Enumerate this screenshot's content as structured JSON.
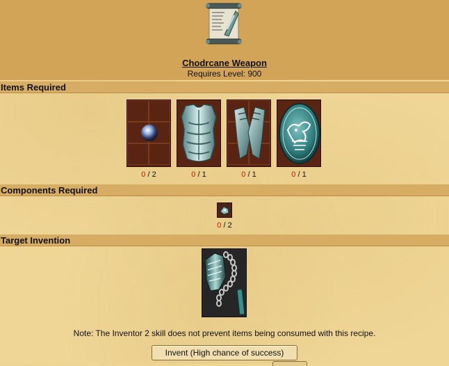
{
  "recipe": {
    "title": "Chodrcane Weapon",
    "requires_level": "Requires Level: 900"
  },
  "sections": {
    "items_required": "Items Required",
    "components_required": "Components Required",
    "target_invention": "Target Invention"
  },
  "items": [
    {
      "icon": "pearl-orb-icon",
      "have": "0",
      "need": " / 2"
    },
    {
      "icon": "breastplate-armor-icon",
      "have": "0",
      "need": " / 1"
    },
    {
      "icon": "gauntlets-icon",
      "have": "0",
      "need": " / 1"
    },
    {
      "icon": "engraved-shield-icon",
      "have": "0",
      "need": " / 1"
    }
  ],
  "components": [
    {
      "icon": "component-gem-icon",
      "have": "0",
      "need": " / 2"
    }
  ],
  "target": {
    "icon": "flail-weapon-icon"
  },
  "note": "Note: The Inventor 2 skill does not prevent items being consumed with this recipe.",
  "invent_button": "Invent (High chance of success)",
  "colors": {
    "have_count": "#c01a00",
    "header_bar": "#d7ad63",
    "top_panel": "#d2a457",
    "parchment": "#efd596"
  }
}
